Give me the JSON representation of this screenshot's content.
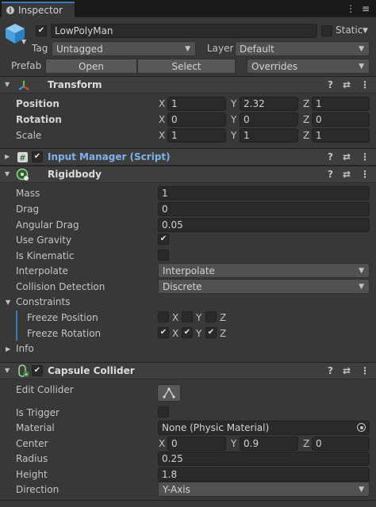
{
  "tab": {
    "label": "Inspector",
    "menu": "⋮ ≡"
  },
  "header": {
    "name": "LowPolyMan",
    "static_label": "Static",
    "tag_label": "Tag",
    "tag_value": "Untagged",
    "layer_label": "Layer",
    "layer_value": "Default",
    "prefab_label": "Prefab",
    "open_label": "Open",
    "select_label": "Select",
    "overrides_label": "Overrides"
  },
  "transform": {
    "title": "Transform",
    "position_label": "Position",
    "rotation_label": "Rotation",
    "scale_label": "Scale",
    "position": {
      "x": "1",
      "y": "2.32",
      "z": "1"
    },
    "rotation": {
      "x": "0",
      "y": "0",
      "z": "0"
    },
    "scale": {
      "x": "1",
      "y": "1",
      "z": "1"
    }
  },
  "input_manager": {
    "title": "Input Manager (Script)"
  },
  "rigidbody": {
    "title": "Rigidbody",
    "mass_label": "Mass",
    "mass": "1",
    "drag_label": "Drag",
    "drag": "0",
    "angular_drag_label": "Angular Drag",
    "angular_drag": "0.05",
    "use_gravity_label": "Use Gravity",
    "is_kinematic_label": "Is Kinematic",
    "interpolate_label": "Interpolate",
    "interpolate_value": "Interpolate",
    "collision_label": "Collision Detection",
    "collision_value": "Discrete",
    "constraints_label": "Constraints",
    "freeze_position_label": "Freeze Position",
    "freeze_rotation_label": "Freeze Rotation",
    "info_label": "Info"
  },
  "axes": {
    "x": "X",
    "y": "Y",
    "z": "Z"
  },
  "capsule": {
    "title": "Capsule Collider",
    "edit_label": "Edit Collider",
    "trigger_label": "Is Trigger",
    "material_label": "Material",
    "material_value": "None (Physic Material)",
    "center_label": "Center",
    "center": {
      "x": "0",
      "y": "0.9",
      "z": "0"
    },
    "radius_label": "Radius",
    "radius": "0.25",
    "height_label": "Height",
    "height": "1.8",
    "direction_label": "Direction",
    "direction_value": "Y-Axis"
  },
  "icons": {
    "help": "?",
    "settings": "⇄",
    "more": "⋮"
  },
  "colors": {
    "accent": "#3a79bb",
    "script_title": "#7fb1ec",
    "background": "#383838"
  }
}
